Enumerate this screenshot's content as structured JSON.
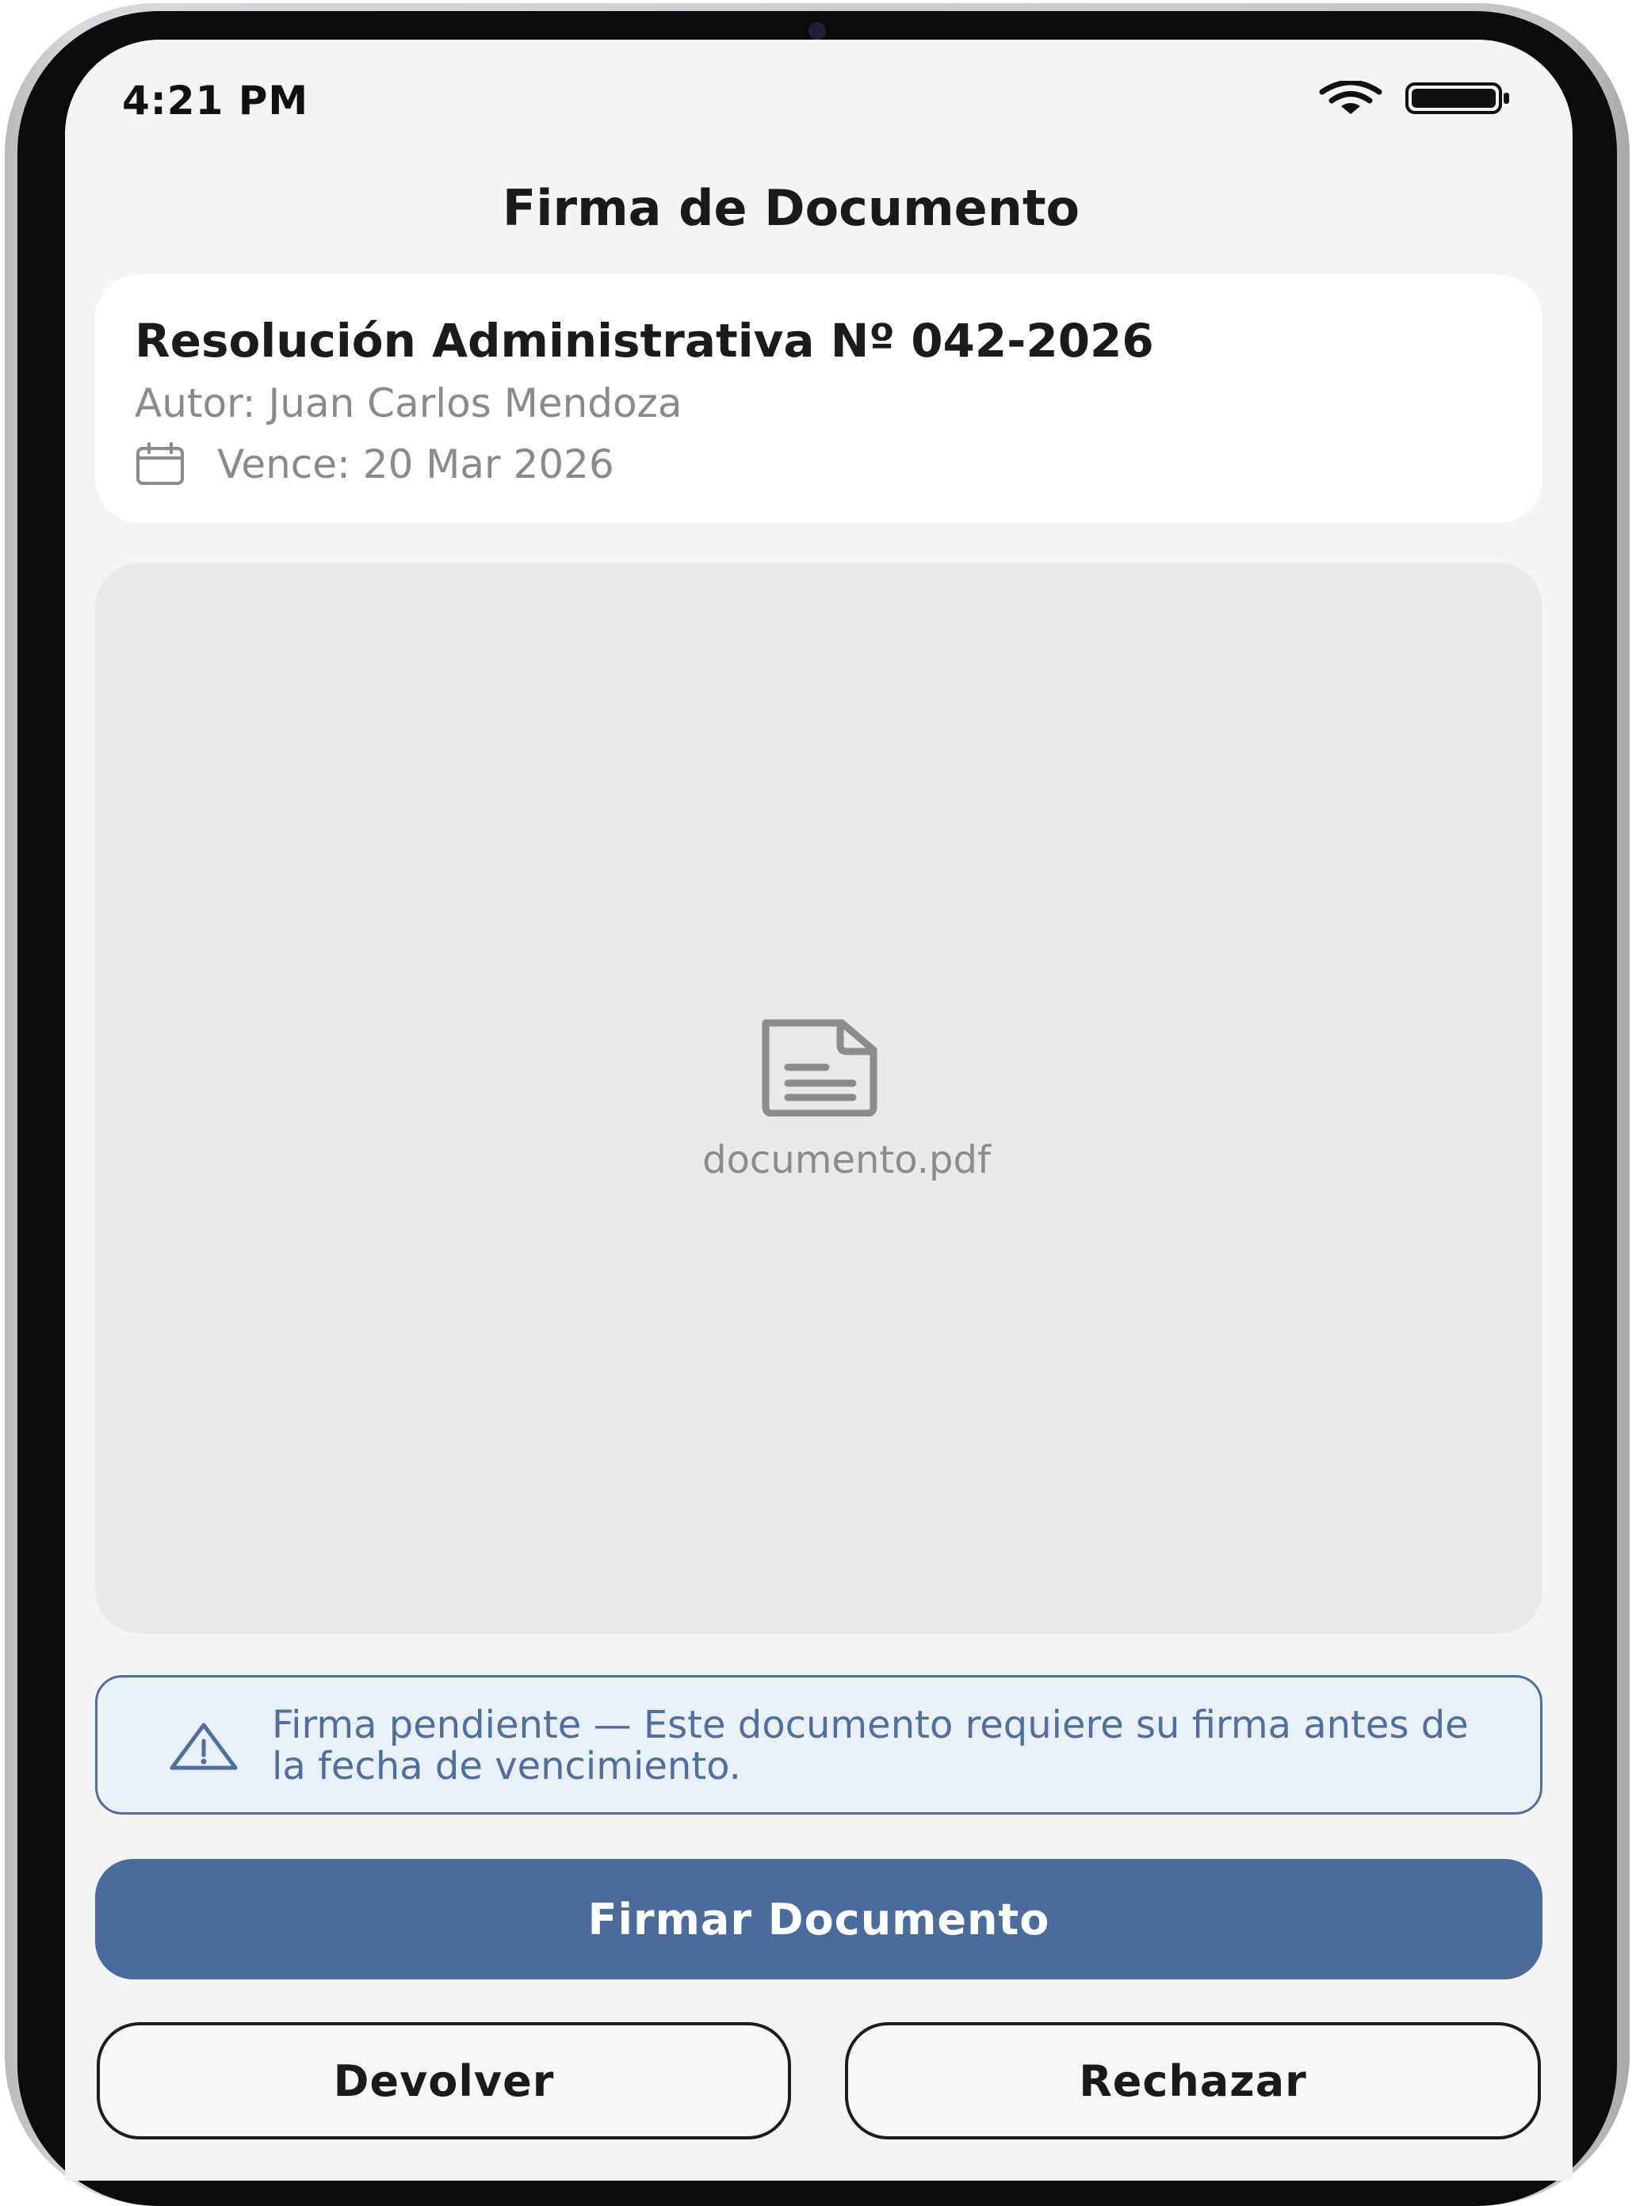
{
  "status_bar": {
    "time": "4:21 PM",
    "wifi_icon": "wifi-icon",
    "battery_icon": "battery-icon"
  },
  "header": {
    "title": "Firma de Documento"
  },
  "document": {
    "title": "Resolución Administrativa Nº 042-2026",
    "author": "Autor: Juan Carlos Mendoza",
    "due_icon": "calendar-icon",
    "due": "Vence: 20 Mar 2026"
  },
  "preview": {
    "file_icon": "document-icon",
    "file_name": "documento.pdf"
  },
  "notice": {
    "icon": "warning-icon",
    "text": "Firma pendiente — Este documento requiere su firma antes de la fecha de vencimiento."
  },
  "actions": {
    "sign_label": "Firmar Documento",
    "return_label": "Devolver",
    "reject_label": "Rechazar"
  },
  "colors": {
    "primary": "#4a6c9d",
    "notice_background": "#eaf0f8",
    "screen_background": "#f4f4f4",
    "preview_background": "#e9e9e9",
    "secondary_text": "#8a8a8a"
  }
}
